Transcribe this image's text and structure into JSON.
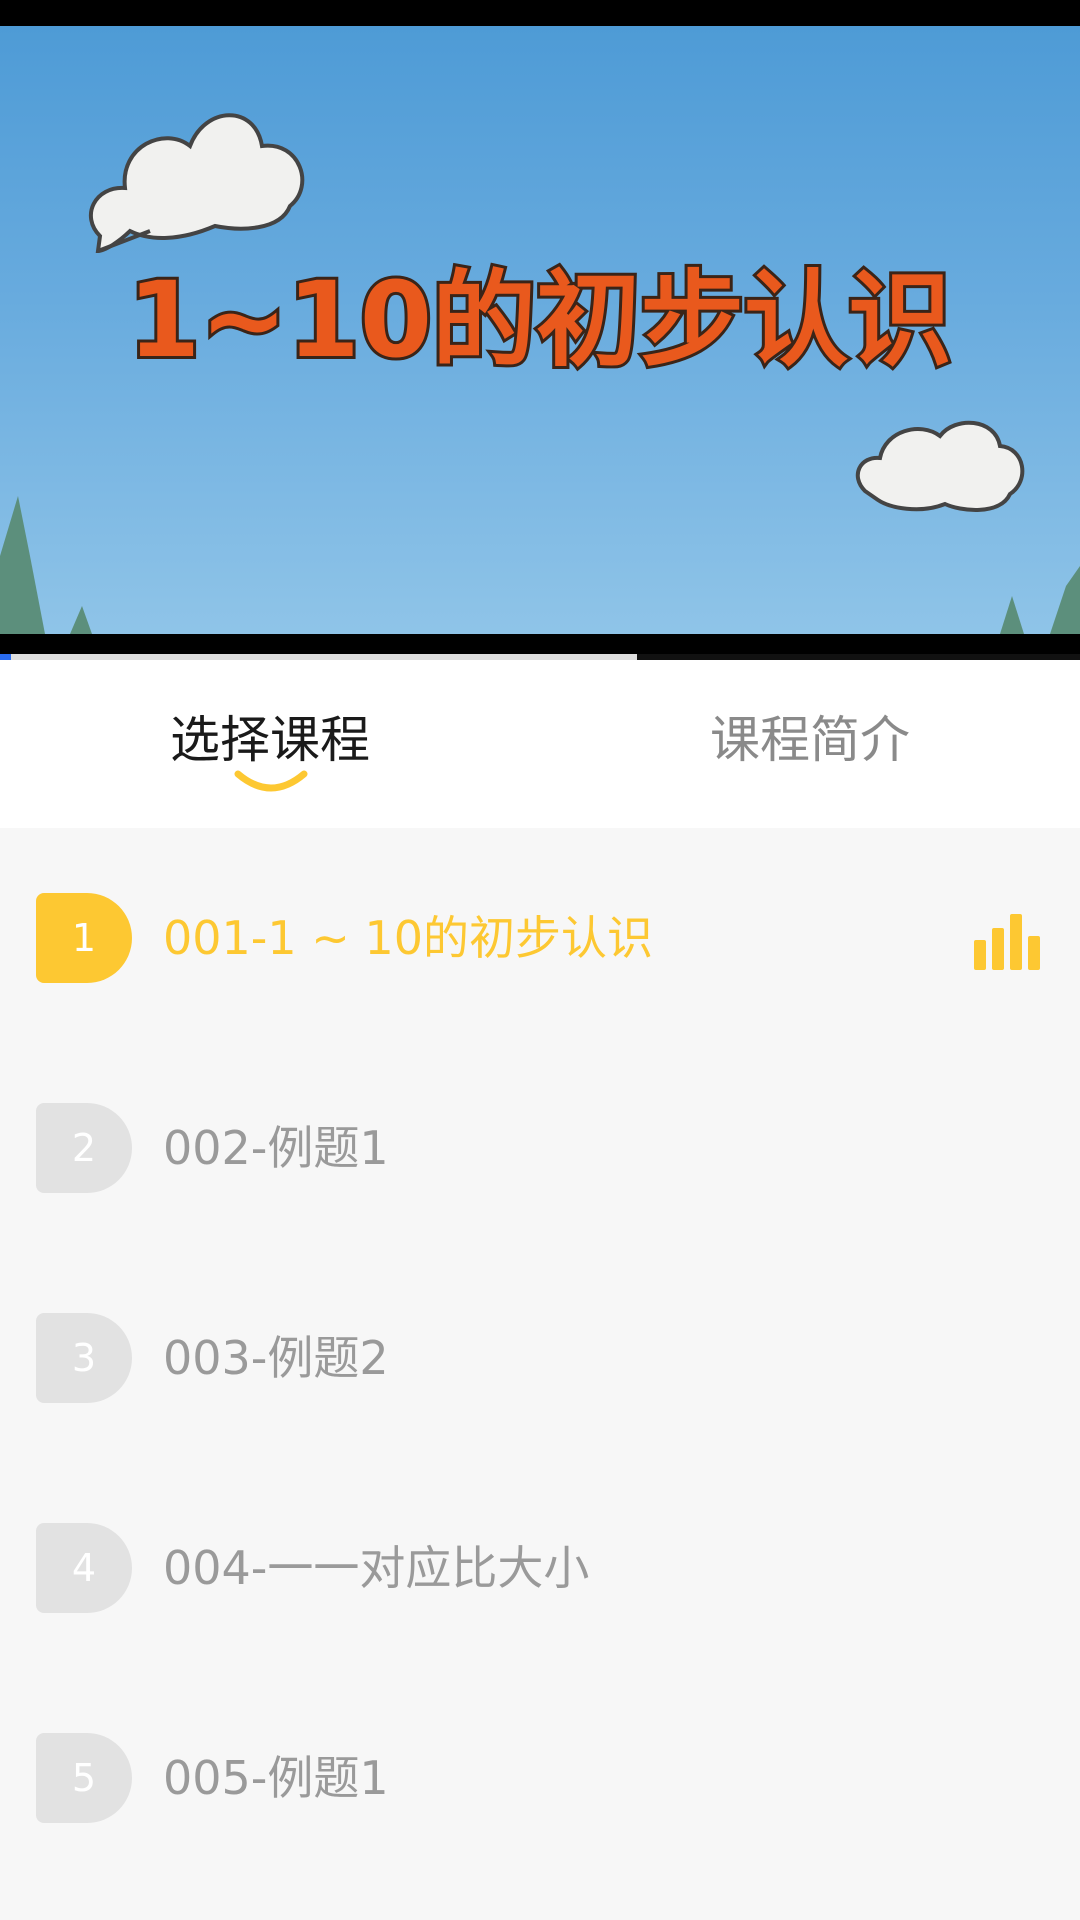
{
  "video": {
    "title_art": "1~10的初步认识",
    "progress_played": 0.01,
    "progress_buffered": 0.59
  },
  "tabs": [
    {
      "label": "选择课程",
      "active": true
    },
    {
      "label": "课程简介",
      "active": false
    }
  ],
  "lessons": [
    {
      "number": "1",
      "title": "001-1 ~ 10的初步认识",
      "active": true,
      "playing": true
    },
    {
      "number": "2",
      "title": "002-例题1",
      "active": false
    },
    {
      "number": "3",
      "title": "003-例题2",
      "active": false
    },
    {
      "number": "4",
      "title": "004-一一对应比大小",
      "active": false
    },
    {
      "number": "5",
      "title": "005-例题1",
      "active": false
    }
  ],
  "colors": {
    "accent": "#fdc832",
    "inactive_text": "#9a9a9a",
    "inactive_badge": "#e2e2e2",
    "progress": "#2a6cf0"
  }
}
